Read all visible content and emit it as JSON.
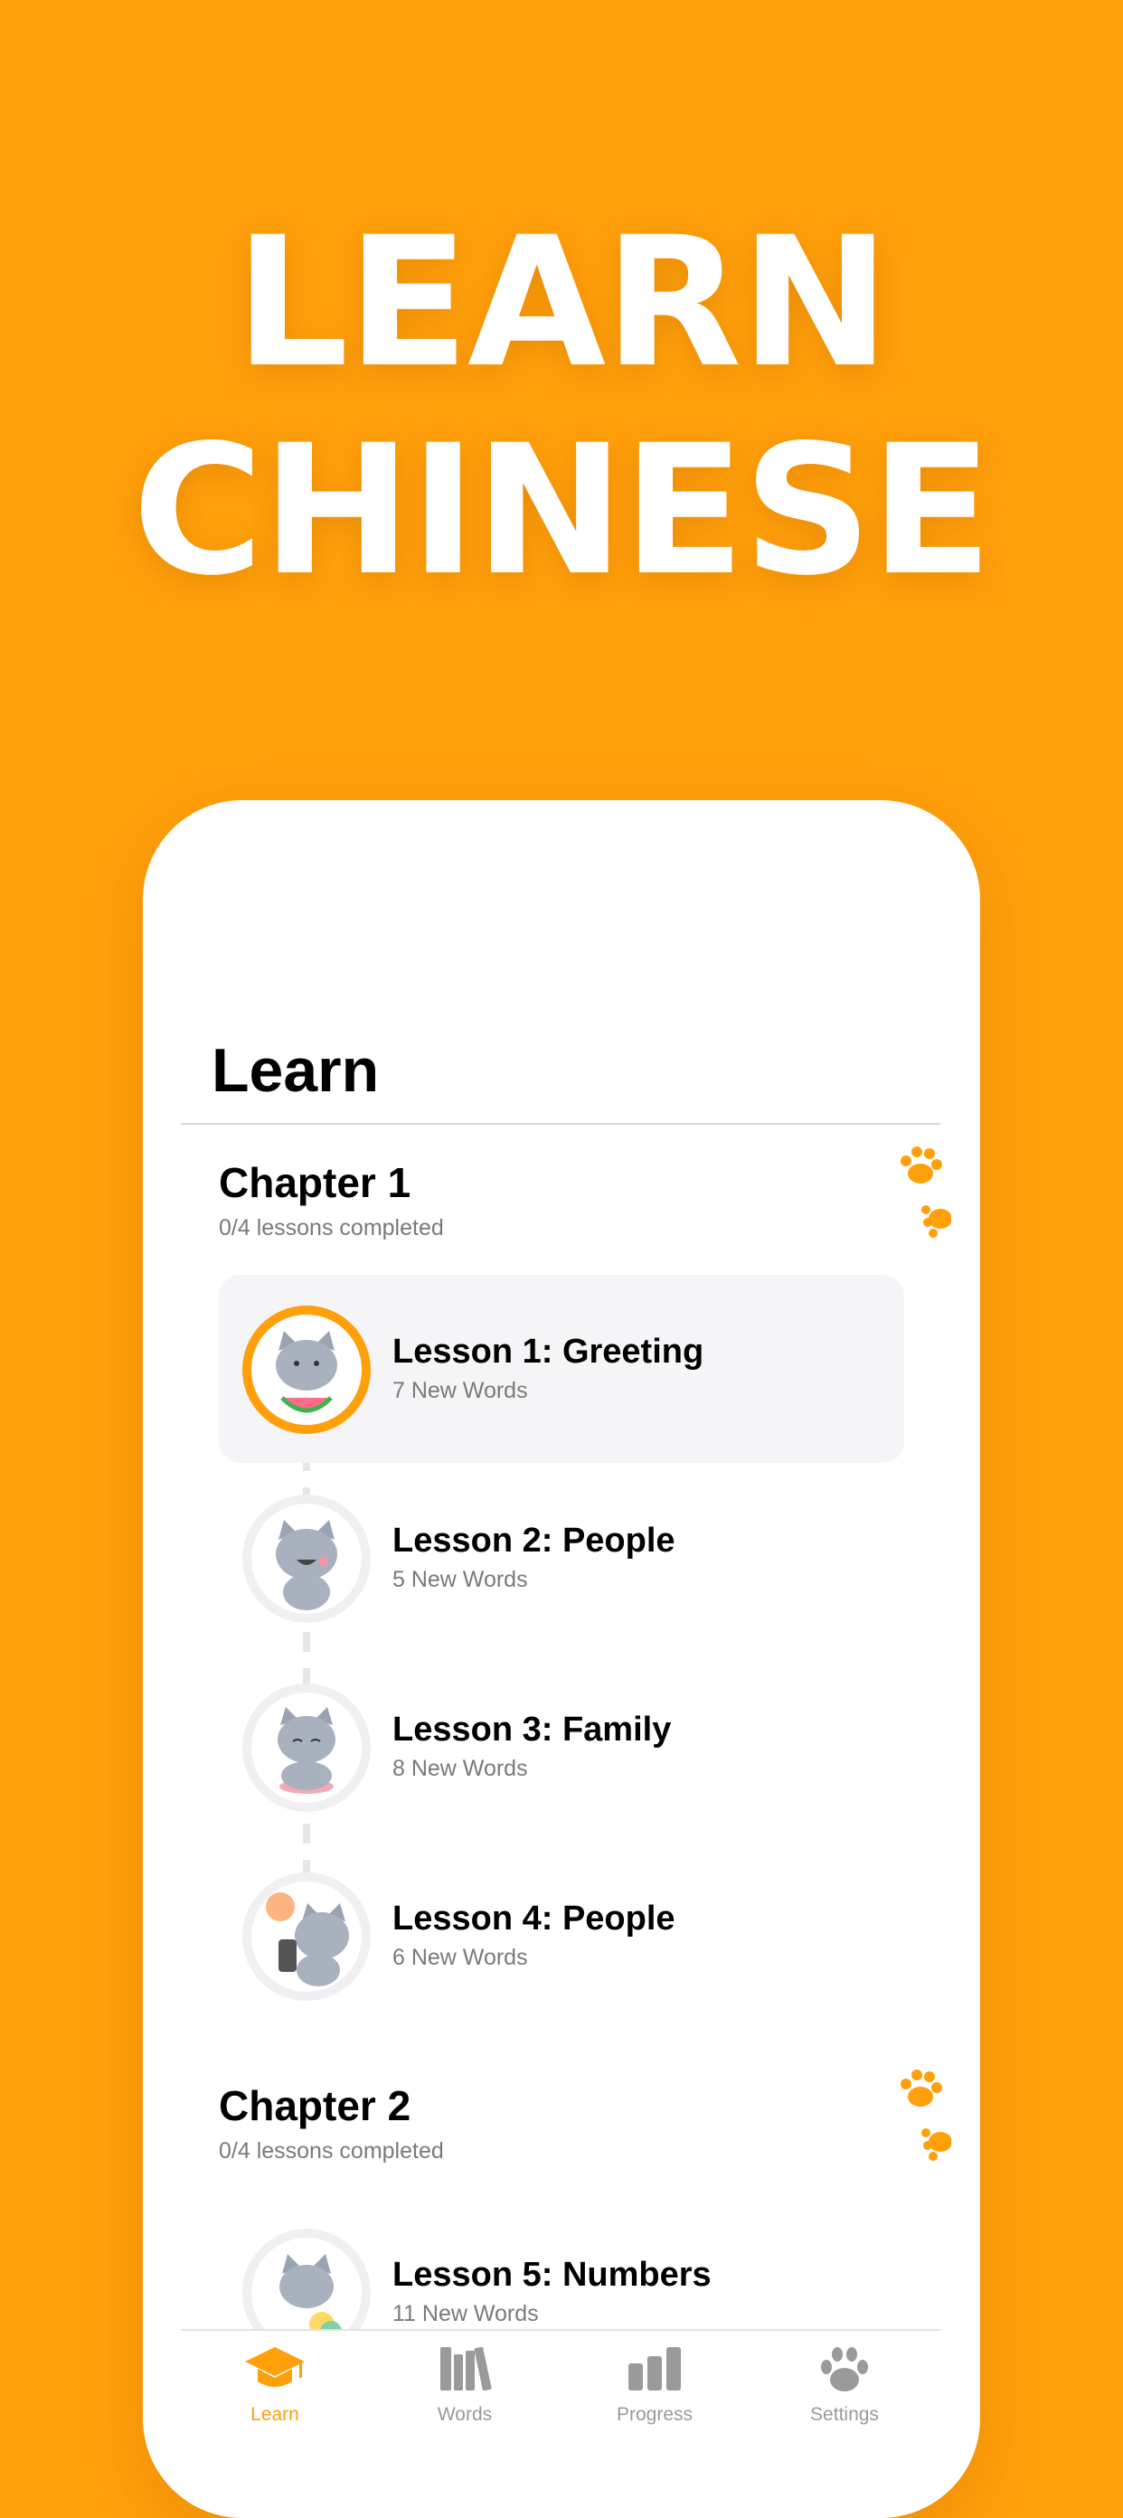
{
  "hero": {
    "line1": "LEARN",
    "line2": "CHINESE"
  },
  "screen": {
    "title": "Learn"
  },
  "chapters": [
    {
      "title": "Chapter 1",
      "subtitle": "0/4 lessons completed"
    },
    {
      "title": "Chapter 2",
      "subtitle": "0/4 lessons completed"
    }
  ],
  "lessons": [
    {
      "name": "Lesson 1: Greeting",
      "words": "7 New Words",
      "active": true,
      "icon": "cat-watermelon-icon"
    },
    {
      "name": "Lesson 2: People",
      "words": "5 New Words",
      "active": false,
      "icon": "cat-laughing-icon"
    },
    {
      "name": "Lesson 3: Family",
      "words": "8 New Words",
      "active": false,
      "icon": "cat-meditating-icon"
    },
    {
      "name": "Lesson 4: People",
      "words": "6 New Words",
      "active": false,
      "icon": "cat-phone-icon"
    },
    {
      "name": "Lesson 5: Numbers",
      "words": "11 New Words",
      "active": false,
      "icon": "cat-numbers-icon"
    }
  ],
  "tabs": [
    {
      "label": "Learn",
      "icon": "graduation-cap-icon",
      "active": true
    },
    {
      "label": "Words",
      "icon": "books-icon",
      "active": false
    },
    {
      "label": "Progress",
      "icon": "bar-chart-icon",
      "active": false
    },
    {
      "label": "Settings",
      "icon": "paw-icon",
      "active": false
    }
  ],
  "colors": {
    "accent": "#FF9F0A",
    "background": "#FF9F0A",
    "card": "#FFFFFF"
  }
}
